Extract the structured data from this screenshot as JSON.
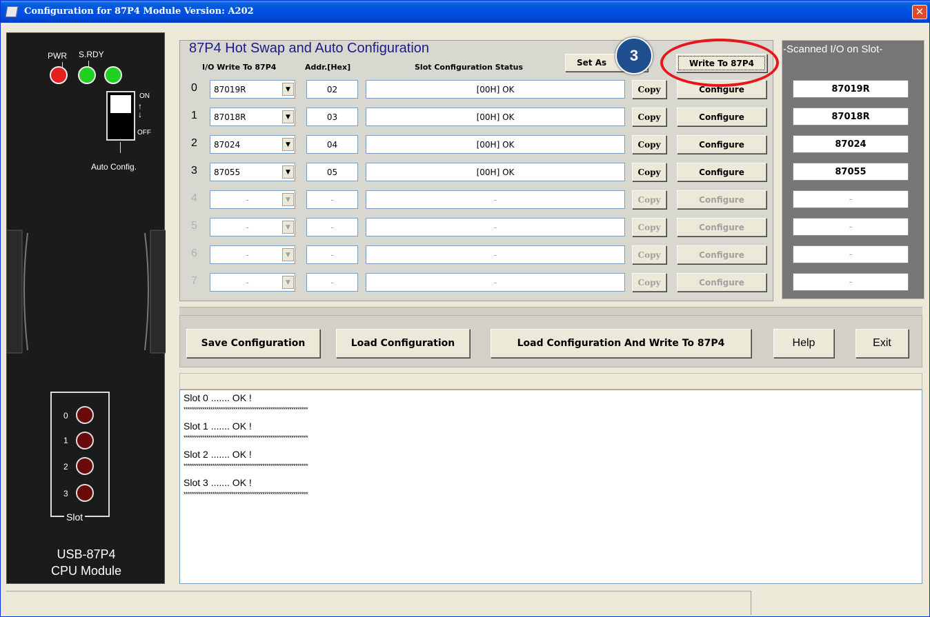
{
  "window": {
    "title": "Configuration for 87P4 Module Version: A202",
    "close_label": "✕"
  },
  "device": {
    "pwr_label": "PWR",
    "srdy_label": "S.RDY",
    "switch_on": "ON",
    "switch_off": "OFF",
    "auto_config_label": "Auto Config.",
    "slot_label": "Slot",
    "slots": [
      "0",
      "1",
      "2",
      "3"
    ],
    "model": "USB-87P4",
    "module": "CPU Module",
    "led_colors": {
      "pwr": "#e52020",
      "srdy": "#22d022",
      "slot": "#6a0a0a"
    }
  },
  "main": {
    "group_title": "87P4 Hot Swap and Auto Configuration",
    "col_io": "I/O Write To 87P4",
    "col_addr": "Addr.[Hex]",
    "col_status": "Slot Configuration Status",
    "set_as_label": "Set As",
    "write_label": "Write To 87P4",
    "copy_label": "Copy",
    "configure_label": "Configure",
    "rows": [
      {
        "num": "0",
        "module": "87019R",
        "addr": "02",
        "status": "[00H] OK",
        "enabled": true
      },
      {
        "num": "1",
        "module": "87018R",
        "addr": "03",
        "status": "[00H] OK",
        "enabled": true
      },
      {
        "num": "2",
        "module": "87024",
        "addr": "04",
        "status": "[00H] OK",
        "enabled": true
      },
      {
        "num": "3",
        "module": "87055",
        "addr": "05",
        "status": "[00H] OK",
        "enabled": true
      },
      {
        "num": "4",
        "module": "-",
        "addr": "-",
        "status": "-",
        "enabled": false
      },
      {
        "num": "5",
        "module": "-",
        "addr": "-",
        "status": "-",
        "enabled": false
      },
      {
        "num": "6",
        "module": "-",
        "addr": "-",
        "status": "-",
        "enabled": false
      },
      {
        "num": "7",
        "module": "-",
        "addr": "-",
        "status": "-",
        "enabled": false
      }
    ]
  },
  "scanned": {
    "title": "Scanned I/O on Slot",
    "items": [
      "87019R",
      "87018R",
      "87024",
      "87055",
      "-",
      "-",
      "-",
      "-"
    ]
  },
  "buttons": {
    "save": "Save Configuration",
    "load": "Load Configuration",
    "load_write": "Load  Configuration And Write To 87P4",
    "help": "Help",
    "exit": "Exit"
  },
  "log": {
    "lines": [
      "Slot  0  .......  OK !",
      "Slot  1  .......  OK !",
      "Slot  2  .......  OK !",
      "Slot  3  .......  OK !"
    ],
    "separator": "************************************************************"
  },
  "annotation": {
    "callout_number": "3",
    "ring_color": "#e8161b"
  }
}
